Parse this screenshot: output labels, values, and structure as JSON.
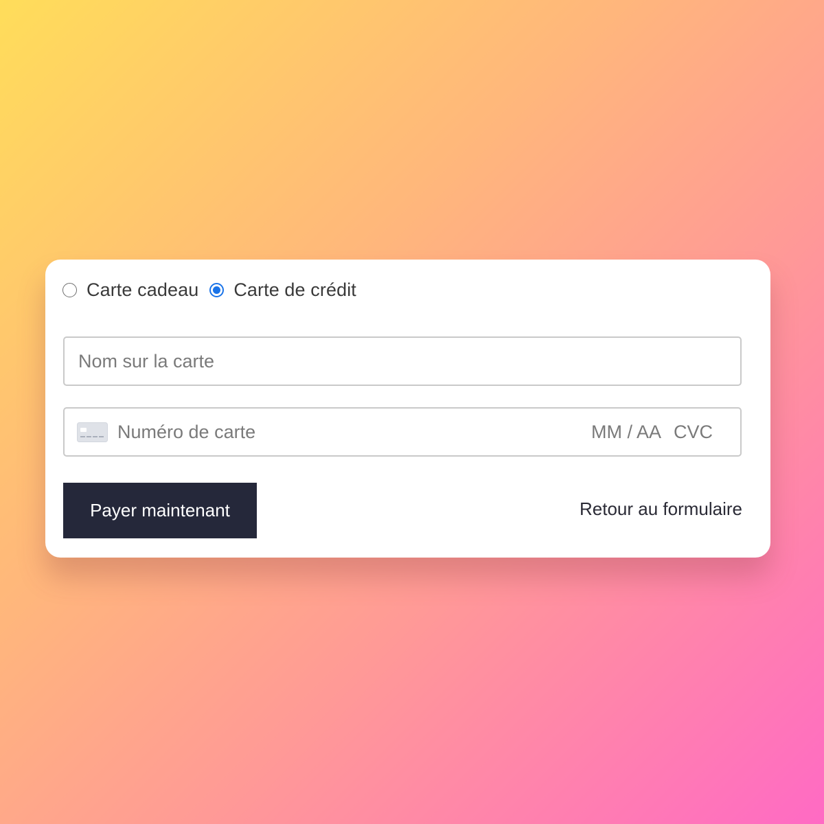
{
  "payment_method": {
    "options": [
      {
        "label": "Carte cadeau",
        "selected": false
      },
      {
        "label": "Carte de crédit",
        "selected": true
      }
    ]
  },
  "form": {
    "name_placeholder": "Nom sur la carte",
    "card_number_placeholder": "Numéro de carte",
    "expiry_placeholder": "MM / AA",
    "cvc_placeholder": "CVC",
    "card_icon": "credit-card-icon"
  },
  "actions": {
    "pay_label": "Payer maintenant",
    "back_label": "Retour au formulaire"
  },
  "colors": {
    "accent": "#1a73e8",
    "button_bg": "#25283a",
    "background_gradient": [
      "#ffdd5a",
      "#ffb67c",
      "#ff9a96",
      "#ff6ac4"
    ]
  }
}
